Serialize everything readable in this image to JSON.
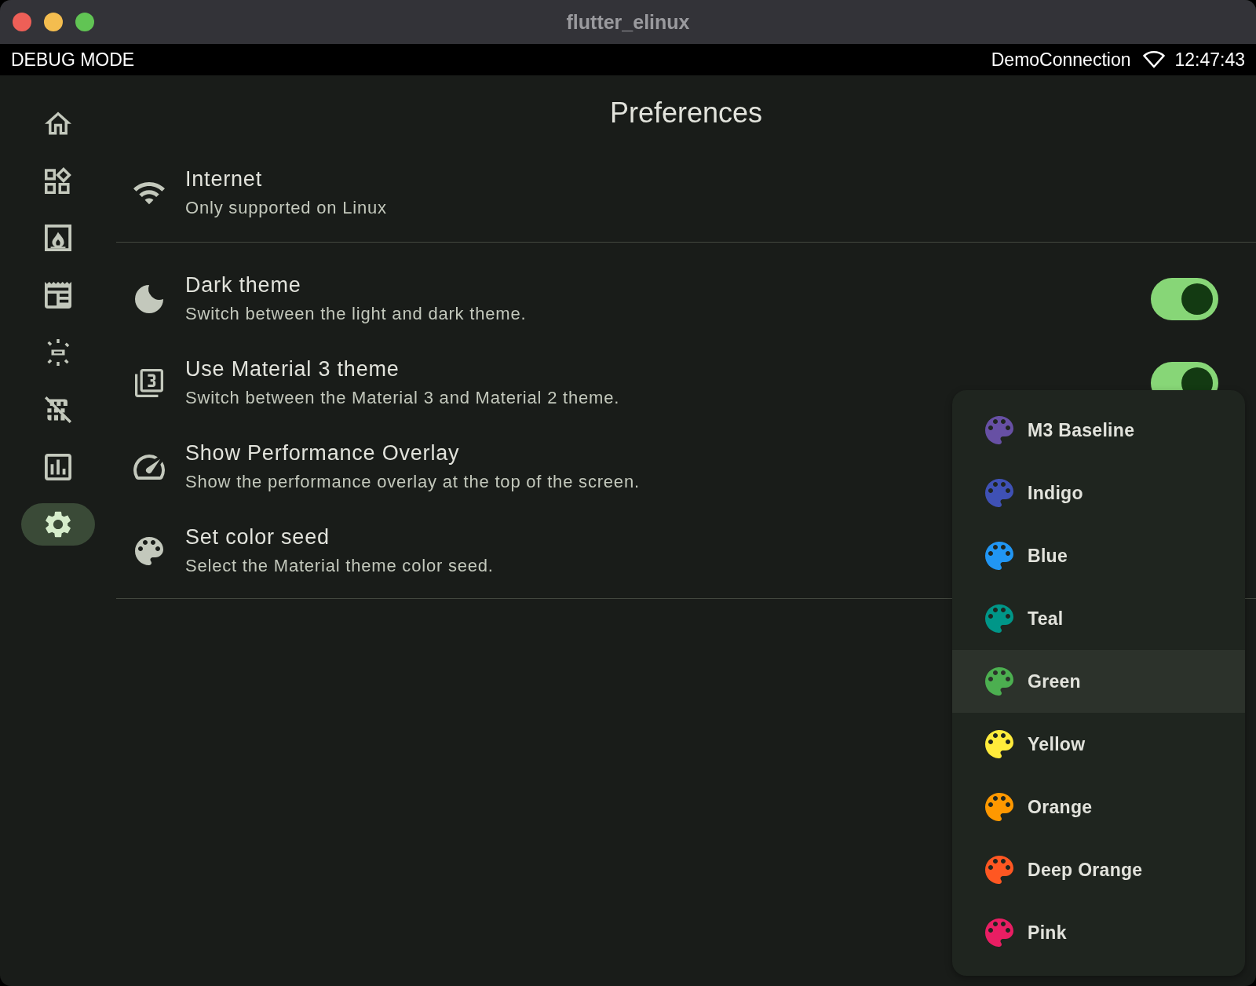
{
  "window": {
    "title": "flutter_elinux"
  },
  "status_bar": {
    "mode": "DEBUG MODE",
    "connection": "DemoConnection",
    "time": "12:47:43"
  },
  "sidebar": {
    "items": [
      {
        "selected": false
      },
      {
        "selected": false
      },
      {
        "selected": false
      },
      {
        "selected": false
      },
      {
        "selected": false
      },
      {
        "selected": false
      },
      {
        "selected": false
      },
      {
        "selected": true
      }
    ]
  },
  "page": {
    "title": "Preferences"
  },
  "sections": [
    {
      "settings": [
        {
          "kind": "plain",
          "title": "Internet",
          "subtitle": "Only supported on Linux"
        }
      ]
    },
    {
      "settings": [
        {
          "kind": "switch",
          "title": "Dark theme",
          "subtitle": "Switch between the light and dark theme.",
          "on": true
        },
        {
          "kind": "switch",
          "title": "Use Material 3 theme",
          "subtitle": "Switch between the Material 3 and Material 2 theme.",
          "on": true
        },
        {
          "kind": "plain",
          "title": "Show Performance Overlay",
          "subtitle": "Show the performance overlay at the top of the screen."
        },
        {
          "kind": "plain",
          "title": "Set color seed",
          "subtitle": "Select the Material theme color seed."
        }
      ]
    }
  ],
  "color_menu": {
    "items": [
      {
        "label": "M3 Baseline",
        "color": "#6750a4",
        "selected": false
      },
      {
        "label": "Indigo",
        "color": "#3f51b5",
        "selected": false
      },
      {
        "label": "Blue",
        "color": "#2196f3",
        "selected": false
      },
      {
        "label": "Teal",
        "color": "#009688",
        "selected": false
      },
      {
        "label": "Green",
        "color": "#4caf50",
        "selected": true
      },
      {
        "label": "Yellow",
        "color": "#ffeb3b",
        "selected": false
      },
      {
        "label": "Orange",
        "color": "#ff9800",
        "selected": false
      },
      {
        "label": "Deep Orange",
        "color": "#ff5722",
        "selected": false
      },
      {
        "label": "Pink",
        "color": "#e91e63",
        "selected": false
      }
    ]
  }
}
